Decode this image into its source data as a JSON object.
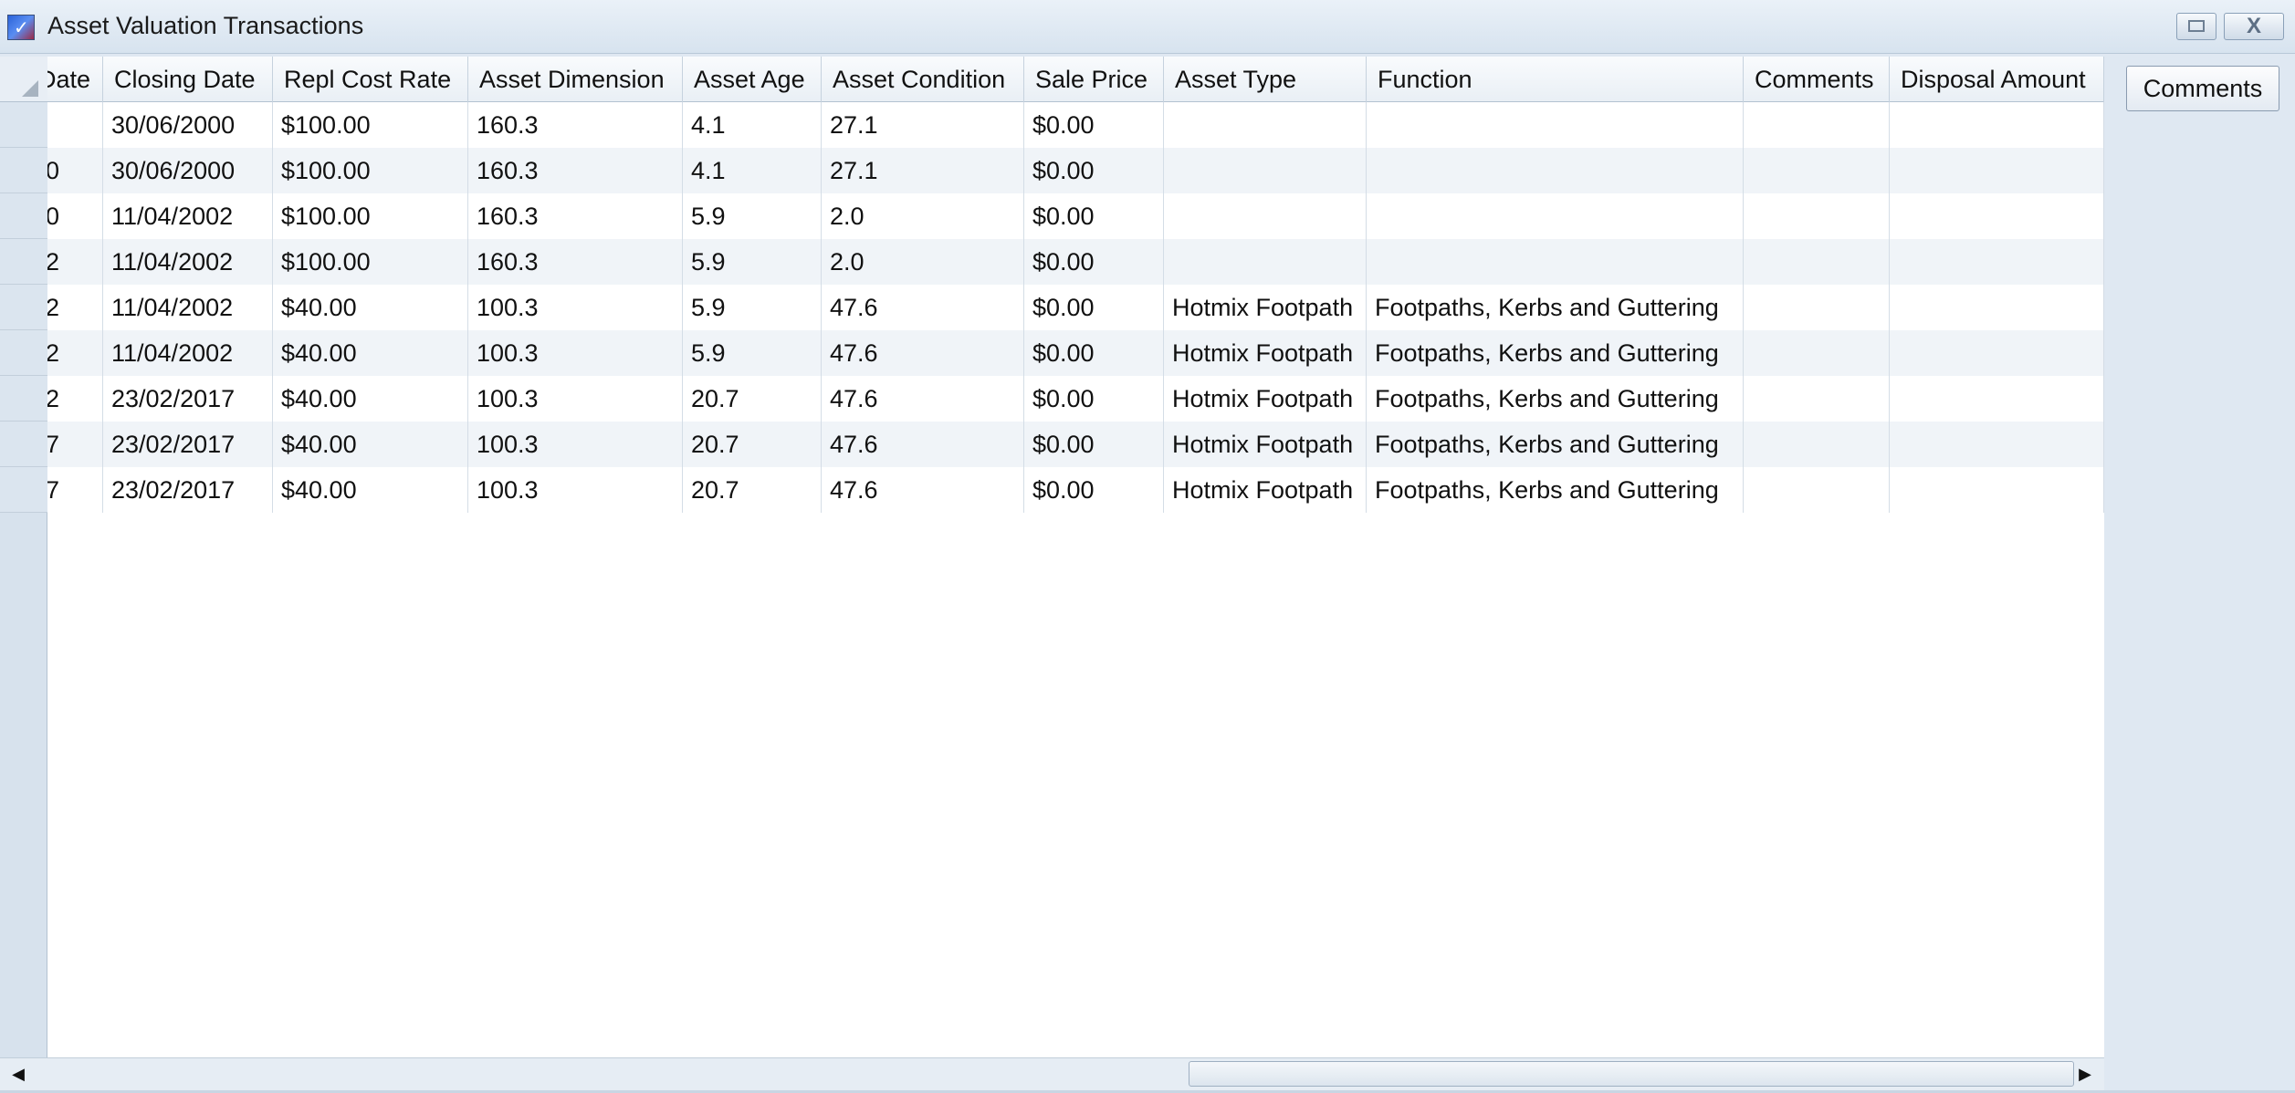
{
  "window": {
    "title": "Asset Valuation Transactions"
  },
  "icons": {
    "app": "app-icon",
    "restore": "restore-icon",
    "close": "close-icon",
    "close_glyph": "X",
    "app_glyph": "✓",
    "scroll_left_glyph": "◀",
    "scroll_right_glyph": "▶"
  },
  "table": {
    "columns": [
      "Date",
      "Closing Date",
      "Repl Cost Rate",
      "Asset Dimension",
      "Asset Age",
      "Asset Condition",
      "Sale Price",
      "Asset Type",
      "Function",
      "Comments",
      "Disposal Amount"
    ],
    "rows": [
      [
        "",
        "30/06/2000",
        "$100.00",
        "160.3",
        "4.1",
        "27.1",
        "$0.00",
        "",
        "",
        "",
        ""
      ],
      [
        "0",
        "30/06/2000",
        "$100.00",
        "160.3",
        "4.1",
        "27.1",
        "$0.00",
        "",
        "",
        "",
        ""
      ],
      [
        "0",
        "11/04/2002",
        "$100.00",
        "160.3",
        "5.9",
        "2.0",
        "$0.00",
        "",
        "",
        "",
        ""
      ],
      [
        "2",
        "11/04/2002",
        "$100.00",
        "160.3",
        "5.9",
        "2.0",
        "$0.00",
        "",
        "",
        "",
        ""
      ],
      [
        "2",
        "11/04/2002",
        "$40.00",
        "100.3",
        "5.9",
        "47.6",
        "$0.00",
        "Hotmix Footpath",
        "Footpaths, Kerbs and Guttering",
        "",
        ""
      ],
      [
        "2",
        "11/04/2002",
        "$40.00",
        "100.3",
        "5.9",
        "47.6",
        "$0.00",
        "Hotmix Footpath",
        "Footpaths, Kerbs and Guttering",
        "",
        ""
      ],
      [
        "2",
        "23/02/2017",
        "$40.00",
        "100.3",
        "20.7",
        "47.6",
        "$0.00",
        "Hotmix Footpath",
        "Footpaths, Kerbs and Guttering",
        "",
        ""
      ],
      [
        "7",
        "23/02/2017",
        "$40.00",
        "100.3",
        "20.7",
        "47.6",
        "$0.00",
        "Hotmix Footpath",
        "Footpaths, Kerbs and Guttering",
        "",
        ""
      ],
      [
        "7",
        "23/02/2017",
        "$40.00",
        "100.3",
        "20.7",
        "47.6",
        "$0.00",
        "Hotmix Footpath",
        "Footpaths, Kerbs and Guttering",
        "",
        ""
      ]
    ]
  },
  "side_panel": {
    "comments_button_label": "Comments"
  },
  "colors": {
    "alt_row": "#f0f4f8",
    "titlebar": "#dfe8f2"
  }
}
